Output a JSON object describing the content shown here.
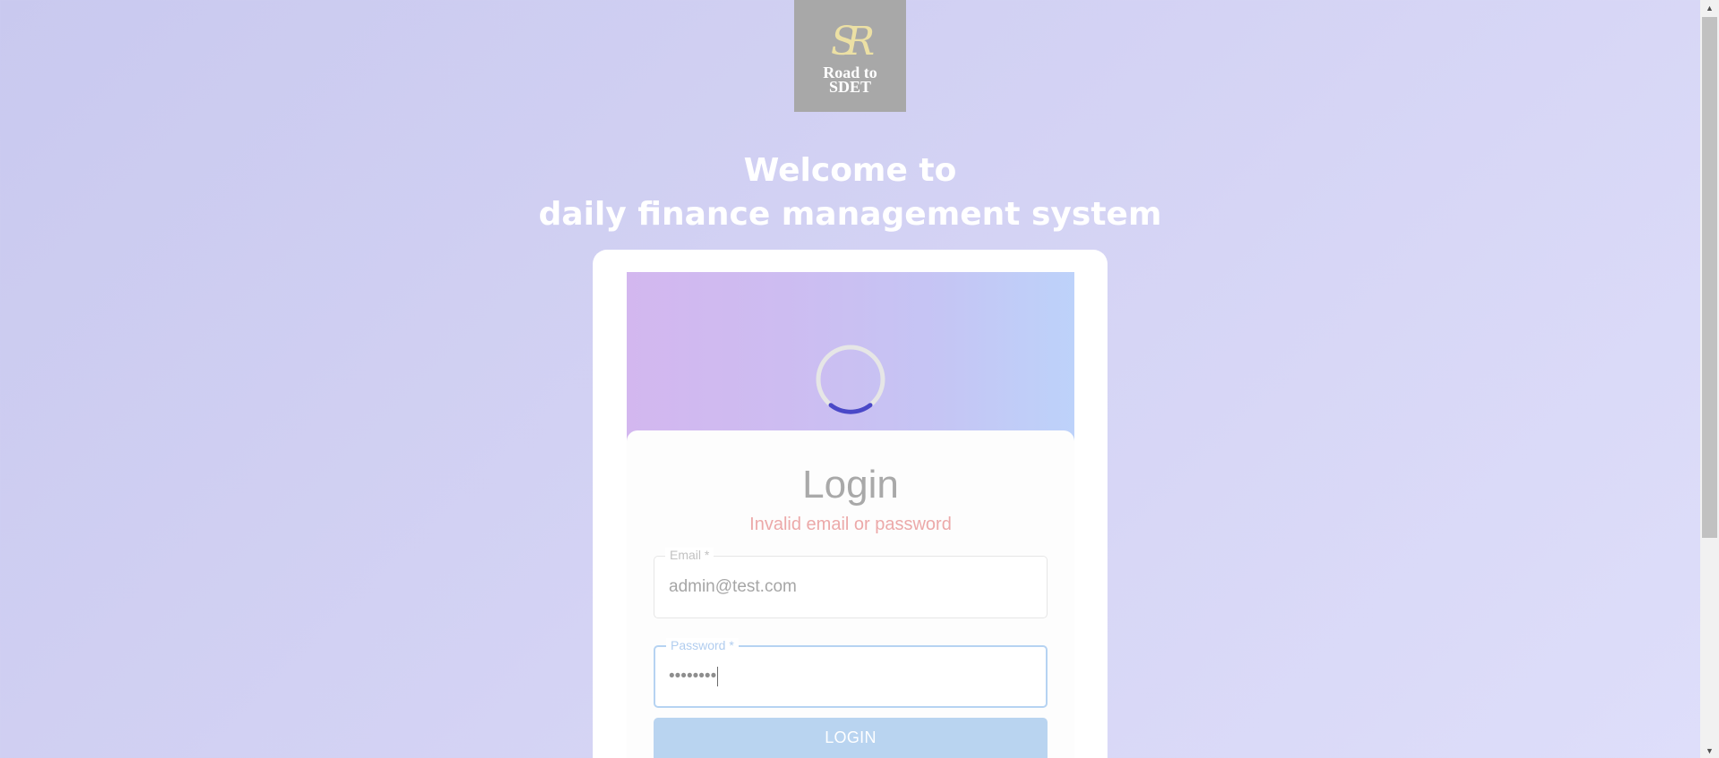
{
  "logo": {
    "monogram": "SR",
    "text": "Road to\nSDET"
  },
  "header": {
    "line1": "Welcome to",
    "line2": "daily finance management system"
  },
  "loader": {
    "icon": "loading-spinner-icon"
  },
  "login": {
    "title": "Login",
    "error": "Invalid email or password",
    "email": {
      "label": "Email *",
      "value": "admin@test.com"
    },
    "password": {
      "label": "Password *",
      "value": "••••••••"
    },
    "button_label": "LOGIN"
  },
  "colors": {
    "background": "#d0d0f2",
    "spinner_track": "#e6e6e6",
    "spinner_arc": "#4a48c8",
    "error": "#eca9a9",
    "button": "#b9d4f0",
    "focus_border": "#b6d3f2"
  },
  "scrollbar": {
    "up_icon": "scroll-up-arrow-icon",
    "down_icon": "scroll-down-arrow-icon"
  }
}
